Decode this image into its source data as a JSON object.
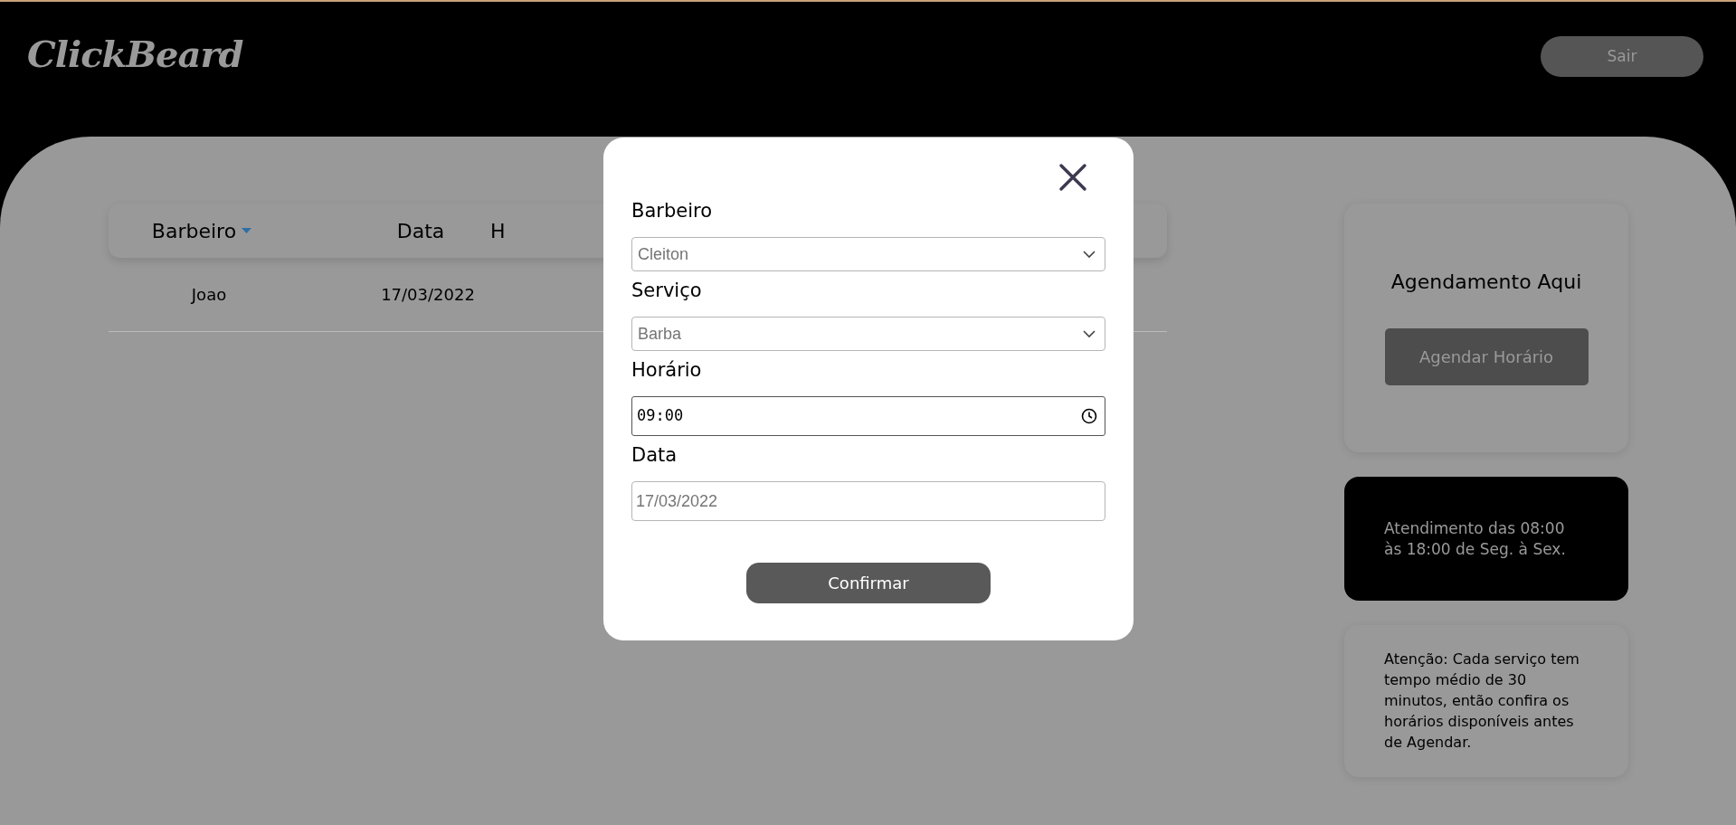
{
  "header": {
    "logo": "ClickBeard",
    "logout_button": "Sair"
  },
  "table": {
    "columns": [
      {
        "label": "Barbeiro",
        "sorted": true
      },
      {
        "label": "Data",
        "sorted": false
      },
      {
        "label": "H",
        "sorted": false
      }
    ],
    "rows": [
      [
        "Joao",
        "17/03/2022"
      ]
    ]
  },
  "booking_card": {
    "title": "Agendamento Aqui",
    "button": "Agendar Horário"
  },
  "hours_card": {
    "text": "Atendimento das 08:00 às 18:00 de Seg. à Sex."
  },
  "notice_card": {
    "text": "Atenção: Cada serviço tem tempo médio de 30 minutos, então confira os horários disponíveis antes de Agendar."
  },
  "modal": {
    "fields": [
      {
        "label": "Barbeiro",
        "kind": "select",
        "value": "Cleiton"
      },
      {
        "label": "Serviço",
        "kind": "select",
        "value": "Barba"
      },
      {
        "label": "Horário",
        "kind": "time",
        "value": "09:00"
      },
      {
        "label": "Data",
        "kind": "text",
        "value": "17/03/2022"
      }
    ],
    "confirm_button": "Confirmar"
  }
}
